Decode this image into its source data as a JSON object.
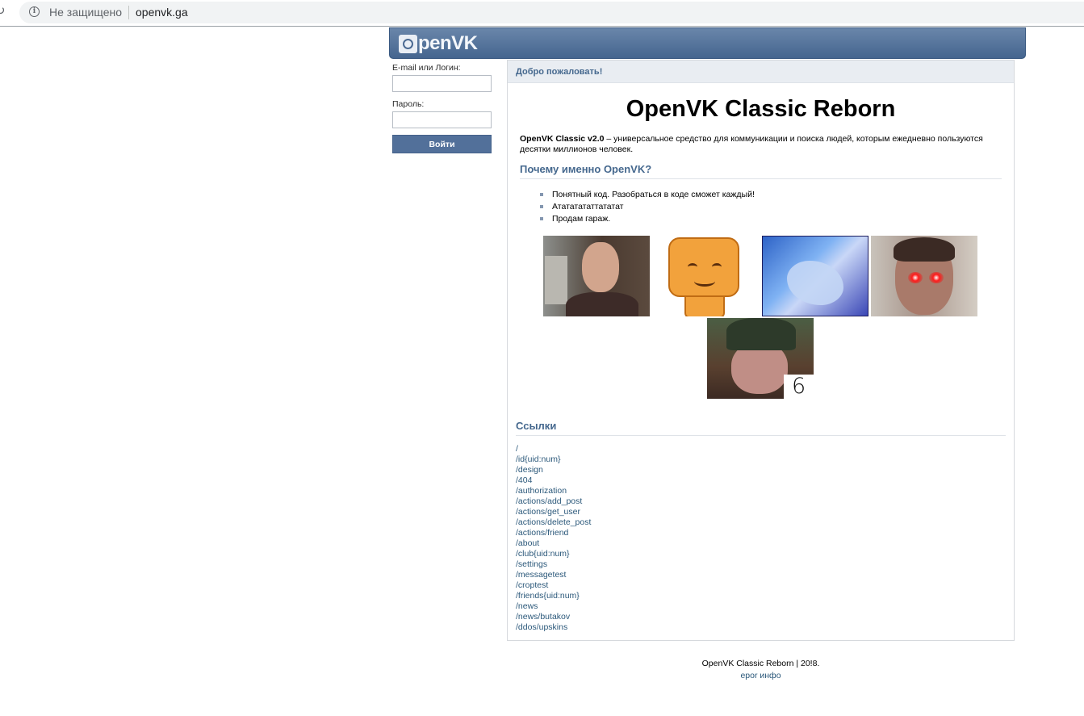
{
  "browser": {
    "security_label": "Не защищено",
    "url": "openvk.ga"
  },
  "header": {
    "logo_text": "penVK"
  },
  "login": {
    "email_label": "E-mail или Логин:",
    "email_value": "",
    "password_label": "Пароль:",
    "password_value": "",
    "submit_label": "Войти"
  },
  "main": {
    "welcome": "Добро пожаловать!",
    "title": "OpenVK Classic Reborn",
    "intro_bold": "OpenVK Classic v2.0",
    "intro_text": " – универсальное средство для коммуникации и поиска людей, которым ежедневно пользуются десятки миллионов человек.",
    "why_heading": "Почему именно OpenVK?",
    "features": [
      "Понятный код. Разобраться в коде сможет каждый!",
      "Атататататтататат",
      "Продам гараж."
    ],
    "image_number": "6",
    "links_heading": "Ссылки",
    "links": [
      "/",
      "/id{uid:num}",
      "/design",
      "/404",
      "/authorization",
      "/actions/add_post",
      "/actions/get_user",
      "/actions/delete_post",
      "/actions/friend",
      "/about",
      "/club{uid:num}",
      "/settings",
      "/messagetest",
      "/croptest",
      "/friends{uid:num}",
      "/news",
      "/news/butakov",
      "/ddos/upskins"
    ]
  },
  "footer": {
    "copyright": "OpenVK Classic Reborn | 20!8.",
    "link": "ероr инфо"
  },
  "colors": {
    "header_blue": "#45658f",
    "link_blue": "#2b587a",
    "heading_blue": "#45688e"
  }
}
